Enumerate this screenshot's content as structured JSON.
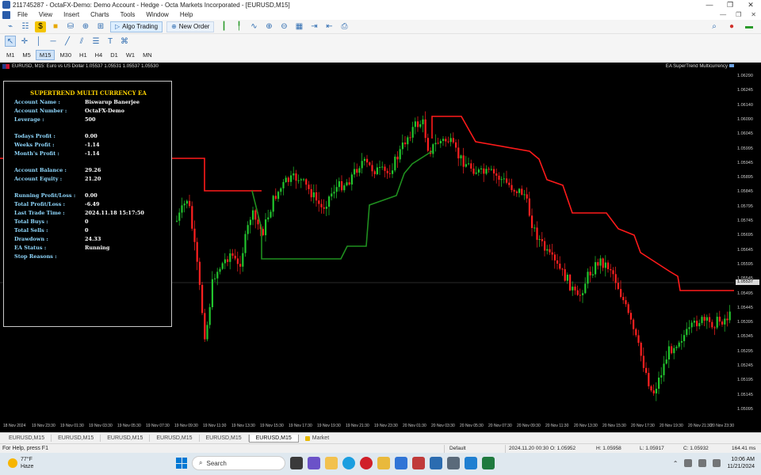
{
  "window": {
    "title": "211745287 - OctaFX-Demo: Demo Account - Hedge - Octa Markets Incorporated - [EURUSD,M15]",
    "controls": [
      "—",
      "❐",
      "✕"
    ]
  },
  "menu": [
    "File",
    "View",
    "Insert",
    "Charts",
    "Tools",
    "Window",
    "Help"
  ],
  "toolbar": {
    "algo_trading": "Algo Trading",
    "new_order": "New Order"
  },
  "timeframes": [
    "M1",
    "M5",
    "M15",
    "M30",
    "H1",
    "H4",
    "D1",
    "W1",
    "MN"
  ],
  "active_timeframe": "M15",
  "chart": {
    "header": "EURUSD, M15:  Euro vs US Dollar  1.05537 1.05531 1.05537 1.05530",
    "ea_label": "EA SuperTrend Multicurrency",
    "price_ticks": [
      "1.06290",
      "1.06245",
      "1.06140",
      "1.06090",
      "1.06045",
      "1.05995",
      "1.05945",
      "1.05895",
      "1.05845",
      "1.05795",
      "1.05745",
      "1.05695",
      "1.05645",
      "1.05595",
      "1.05545",
      "1.05495",
      "1.05445",
      "1.05395",
      "1.05345",
      "1.05295",
      "1.05245",
      "1.05195",
      "1.05145",
      "1.05095"
    ],
    "price_tag": "1.05537",
    "time_ticks": [
      "18 Nov 2024",
      "19 Nov 23:30",
      "19 Nov 01:30",
      "19 Nov 03:30",
      "19 Nov 05:30",
      "19 Nov 07:30",
      "19 Nov 09:30",
      "19 Nov 11:30",
      "19 Nov 13:30",
      "19 Nov 15:30",
      "19 Nov 17:30",
      "19 Nov 19:30",
      "19 Nov 21:30",
      "19 Nov 23:30",
      "20 Nov 01:30",
      "20 Nov 03:30",
      "20 Nov 05:30",
      "20 Nov 07:30",
      "20 Nov 09:30",
      "20 Nov 11:30",
      "20 Nov 13:30",
      "20 Nov 15:30",
      "20 Nov 17:30",
      "20 Nov 19:30",
      "20 Nov 21:30",
      "20 Nov 23:30"
    ],
    "colors": {
      "bull": "#22c52e",
      "bear": "#ff2020",
      "trend_down": "#ff1a1a",
      "trend_up": "#1f8f1f"
    }
  },
  "ea_panel": {
    "title": "SUPERTREND MULTI CURRENCY EA",
    "rows": [
      {
        "label": "Account Name :",
        "value": "Biswarup Banerjee"
      },
      {
        "label": "Account Number :",
        "value": "OctaFX-Demo"
      },
      {
        "label": "Leverage :",
        "value": "500"
      },
      {
        "label": "Todays Profit :",
        "value": "0.00"
      },
      {
        "label": "Weeks Profit :",
        "value": "-1.14"
      },
      {
        "label": "Month's Profit :",
        "value": "-1.14"
      },
      {
        "label": "Account Balance :",
        "value": "29.26"
      },
      {
        "label": "Account Equity :",
        "value": "21.20"
      },
      {
        "label": "Running Profit/Loss :",
        "value": "0.00"
      },
      {
        "label": "Total Profit/Loss :",
        "value": "-6.49"
      },
      {
        "label": "Last Trade Time :",
        "value": "2024.11.18 15:17:50"
      },
      {
        "label": "Total Buys :",
        "value": "0"
      },
      {
        "label": "Total Sells :",
        "value": "0"
      },
      {
        "label": "Drawdown :",
        "value": "24.33"
      },
      {
        "label": "EA Status :",
        "value": "Running"
      },
      {
        "label": "Stop Reasons :",
        "value": ""
      }
    ]
  },
  "tabs": [
    "EURUSD,M15",
    "EURUSD,M15",
    "EURUSD,M15",
    "EURUSD,M15",
    "EURUSD,M15",
    "EURUSD,M15"
  ],
  "active_tab_index": 5,
  "market_tab": "Market",
  "status": {
    "help": "For Help, press F1",
    "profile": "Default",
    "datetime": "2024.11.20 00:30",
    "open": "O: 1.05952",
    "high": "H: 1.05958",
    "low": "L: 1.05917",
    "close": "C: 1.05932",
    "ping": "164.41 ms"
  },
  "taskbar": {
    "weather_temp": "77°F",
    "weather_desc": "Haze",
    "search": "Search",
    "time": "10:06 AM",
    "date": "11/21/2024"
  }
}
